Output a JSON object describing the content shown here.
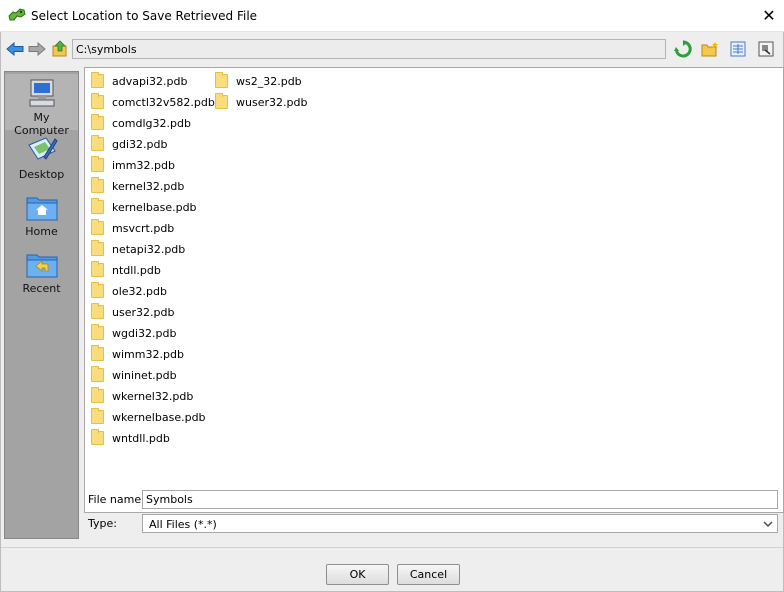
{
  "window": {
    "title": "Select Location to Save Retrieved File",
    "close_glyph": "✕"
  },
  "toolbar": {
    "path": "C:\\symbols",
    "icons": [
      "back-arrow-icon",
      "forward-arrow-icon",
      "up-folder-icon",
      "refresh-icon",
      "new-folder-icon",
      "list-view-icon",
      "details-view-icon"
    ]
  },
  "places": [
    {
      "label": "My Computer",
      "icon": "computer-icon"
    },
    {
      "label": "Desktop",
      "icon": "desktop-icon"
    },
    {
      "label": "Home",
      "icon": "home-icon"
    },
    {
      "label": "Recent",
      "icon": "recent-icon"
    }
  ],
  "files": [
    "advapi32.pdb",
    "comctl32v582.pdb",
    "comdlg32.pdb",
    "gdi32.pdb",
    "imm32.pdb",
    "kernel32.pdb",
    "kernelbase.pdb",
    "msvcrt.pdb",
    "netapi32.pdb",
    "ntdll.pdb",
    "ole32.pdb",
    "user32.pdb",
    "wgdi32.pdb",
    "wimm32.pdb",
    "wininet.pdb",
    "wkernel32.pdb",
    "wkernelbase.pdb",
    "wntdll.pdb",
    "ws2_32.pdb",
    "wuser32.pdb"
  ],
  "file_name": {
    "label": "File name:",
    "value": "Symbols"
  },
  "file_type": {
    "label": "Type:",
    "value": "All Files (*.*)"
  },
  "buttons": {
    "ok": "OK",
    "cancel": "Cancel"
  },
  "colors": {
    "folder": "#f9dc7c",
    "places_bg": "#a3a3a3",
    "dialog_bg": "#eeeeee",
    "accent_green": "#2e9e3a",
    "accent_blue": "#2a6fcf"
  }
}
